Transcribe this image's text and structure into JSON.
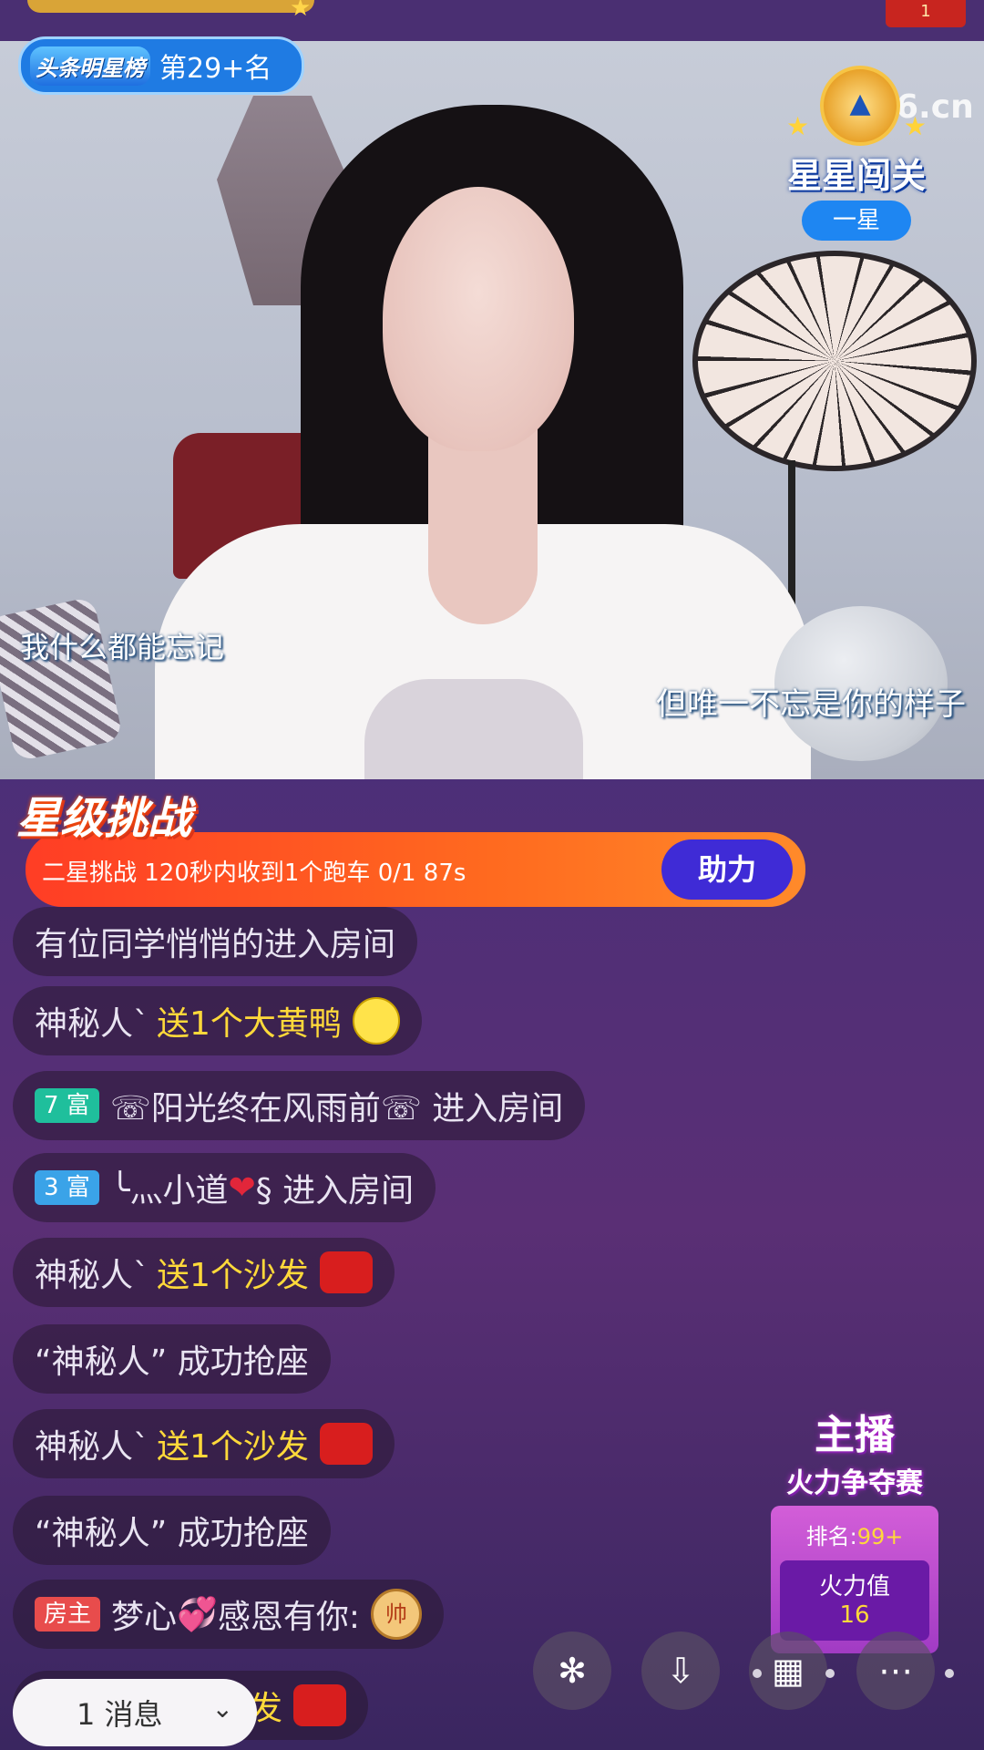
{
  "top": {
    "badge_value": "1"
  },
  "rank": {
    "logo": "头条明星榜",
    "text": "第29+名"
  },
  "watermark": "6.cn",
  "star_badge": {
    "title": "星星闯关",
    "level": "一星"
  },
  "subtitles": {
    "left": "我什么都能忘记",
    "right": "但唯一不忘是你的样子"
  },
  "challenge": {
    "title": "星级挑战",
    "text": "二星挑战  120秒内收到1个跑车 0/1 87s",
    "button": "助力"
  },
  "chat": [
    {
      "text": "有位同学悄悄的进入房间"
    },
    {
      "user": "神秘人`",
      "gift": "送1个大黄鸭",
      "icon": "duck-icon"
    },
    {
      "badge": "7 富",
      "badge_color": "teal",
      "text": "☏阳光终在风雨前☏ 进入房间"
    },
    {
      "badge": "3 富",
      "badge_color": "blue",
      "text_a": "╰灬小道",
      "text_b": "§ 进入房间"
    },
    {
      "user": "神秘人`",
      "gift": "送1个沙发",
      "icon": "sofa-icon"
    },
    {
      "text": "“神秘人” 成功抢座"
    },
    {
      "user": "神秘人`",
      "gift": "送1个沙发",
      "icon": "sofa-icon"
    },
    {
      "text": "“神秘人” 成功抢座"
    },
    {
      "badge": "房主",
      "badge_color": "red",
      "text_a": "梦心",
      "text_b": "感恩有你:",
      "icon_text": "帅"
    },
    {
      "gift": "个沙发",
      "icon": "sofa-icon"
    }
  ],
  "competition": {
    "title": "主播",
    "subtitle": "火力争夺赛",
    "rank_label": "排名:",
    "rank_value": "99+",
    "fire_label": "火力值",
    "fire_value": "16"
  },
  "bottom": {
    "message_count": "1 消息",
    "buttons": [
      "share-icon",
      "download-icon",
      "grid-icon",
      "more-icon"
    ]
  }
}
